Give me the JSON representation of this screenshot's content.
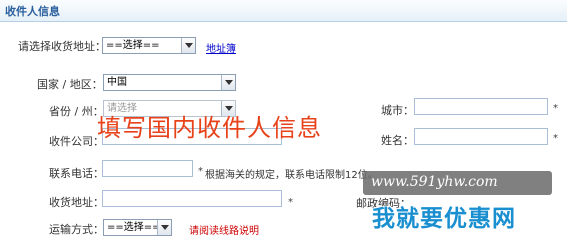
{
  "header": {
    "title": "收件人信息"
  },
  "address_select": {
    "label": "请选择收货地址：",
    "value": "==选择==",
    "link": "地址簿"
  },
  "country": {
    "label": "国家 / 地区：",
    "value": "中国"
  },
  "province": {
    "label": "省份 / 州：",
    "value": "请选择"
  },
  "city": {
    "label": "城市：",
    "value": ""
  },
  "company": {
    "label": "收件公司：",
    "value": ""
  },
  "name": {
    "label": "姓名：",
    "value": ""
  },
  "phone": {
    "label": "联系电话：",
    "value": "",
    "note": "根据海关的规定，联系电话限制12位。"
  },
  "address": {
    "label": "收货地址：",
    "value": ""
  },
  "zip": {
    "label": "邮政编码："
  },
  "shipping": {
    "label": "运输方式：",
    "value": "==选择==",
    "note": "请阅读线路说明"
  },
  "required_mark": "*",
  "overlay_text": "填写国内收件人信息",
  "watermark": {
    "url": "www.591yhw.com",
    "brand": "我就要优惠网"
  }
}
